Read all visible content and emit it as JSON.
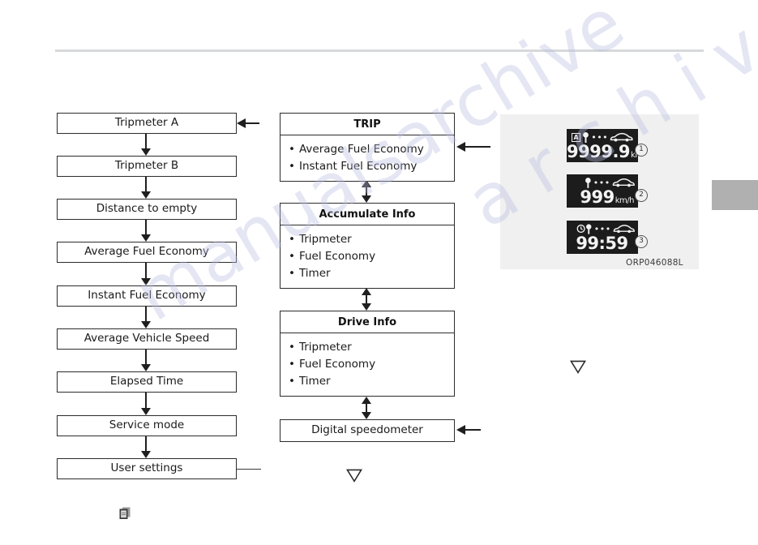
{
  "page": {
    "illustration_code": "ORP046088L",
    "watermark_left": "manualsarchive",
    "watermark_right": "a r c h i v e . c o m"
  },
  "left_flow": {
    "name": "trip-computer-mode-sequence",
    "steps": [
      {
        "label": "Tripmeter A"
      },
      {
        "label": "Tripmeter B"
      },
      {
        "label": "Distance to empty"
      },
      {
        "label": "Average Fuel Economy"
      },
      {
        "label": "Instant Fuel Economy"
      },
      {
        "label": "Average Vehicle Speed"
      },
      {
        "label": "Elapsed Time"
      },
      {
        "label": "Service mode"
      },
      {
        "label": "User settings"
      }
    ]
  },
  "middle_flow": {
    "name": "trip-computer-groups",
    "groups": [
      {
        "title": "TRIP",
        "items": [
          "Average Fuel Economy",
          "Instant Fuel Economy"
        ]
      },
      {
        "title": "Accumulate Info",
        "items": [
          "Tripmeter",
          "Fuel Economy",
          "Timer"
        ]
      },
      {
        "title": "Drive Info",
        "items": [
          "Tripmeter",
          "Fuel Economy",
          "Timer"
        ]
      }
    ],
    "speedometer": {
      "label": "Digital speedometer"
    }
  },
  "illustration": {
    "displays": [
      {
        "callout": "1",
        "icons": [
          "tripmeter-a-icon",
          "fuel-pump-icon",
          "range-dots-icon",
          "car-icon"
        ],
        "badge": "A",
        "value": "9999.9",
        "unit": "km"
      },
      {
        "callout": "2",
        "icons": [
          "fuel-pump-icon",
          "range-dots-icon",
          "car-icon"
        ],
        "badge": "",
        "value": "999",
        "unit": "km/h"
      },
      {
        "callout": "3",
        "icons": [
          "clock-icon",
          "fuel-pump-icon",
          "range-dots-icon",
          "car-icon"
        ],
        "badge": "",
        "value": "99:59",
        "unit": ""
      }
    ]
  },
  "markers": {
    "triangle_icon": "triangle-down-icon",
    "doc_icon": "document-pages-icon"
  },
  "colors": {
    "line": "#1f1f1f",
    "box_border": "#2c2c2c",
    "panel_bg": "#f0f0f0",
    "lcd_bg": "#1c1c1c",
    "lcd_text": "#f3f3f3",
    "rule": "#d7d9db",
    "tab": "#b0b0b0",
    "watermark": "#b9bfe0"
  }
}
